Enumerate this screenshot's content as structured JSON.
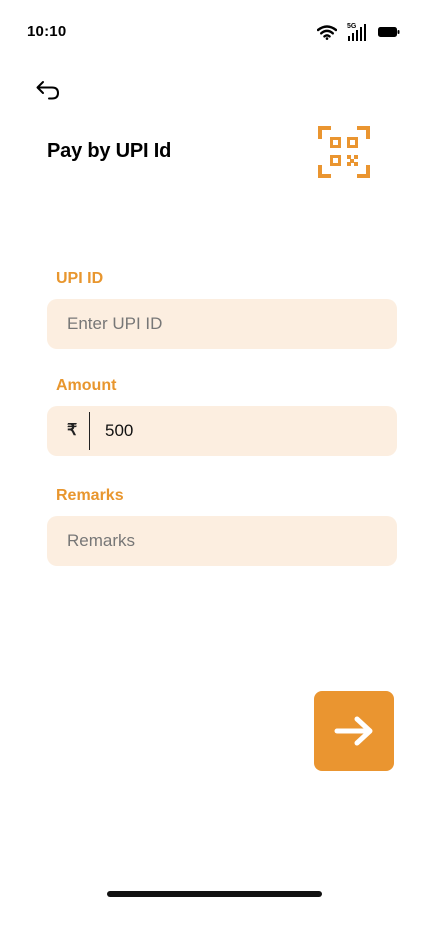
{
  "status_bar": {
    "time": "10:10",
    "network": "5G"
  },
  "header": {
    "back_icon": "back-arrow-icon",
    "title": "Pay by UPI Id",
    "qr_icon": "qr-code-scan-icon"
  },
  "form": {
    "upi": {
      "label": "UPI ID",
      "value": "",
      "placeholder": "Enter UPI ID"
    },
    "amount": {
      "label": "Amount",
      "currency_symbol": "₹",
      "value": "500",
      "placeholder": ""
    },
    "remarks": {
      "label": "Remarks",
      "value": "",
      "placeholder": "Remarks"
    }
  },
  "submit": {
    "icon": "arrow-right-icon"
  },
  "colors": {
    "accent": "#EA9530",
    "field_background": "#FCEEE0",
    "label": "#E8962E"
  }
}
